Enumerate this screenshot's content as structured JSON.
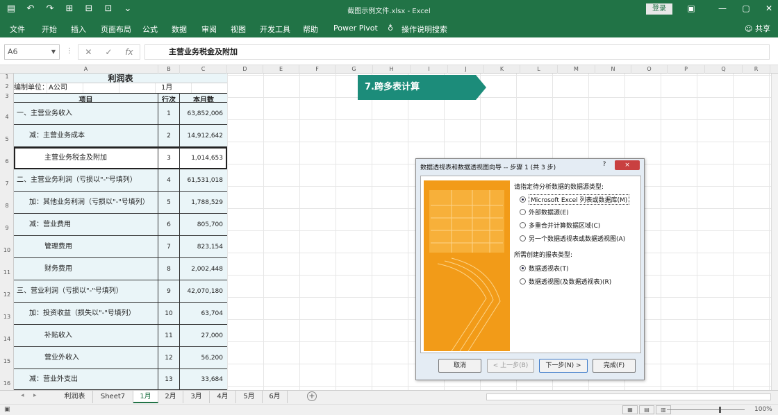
{
  "titlebar": {
    "doc_title": "截图示例文件.xlsx - Excel",
    "login_label": "登录",
    "icons": [
      "save-icon",
      "undo-icon",
      "redo-icon",
      "separator",
      "window-restore-icon",
      "minimize-icon",
      "maximize-icon",
      "close-icon"
    ]
  },
  "menu": {
    "tabs": [
      "文件",
      "开始",
      "插入",
      "页面布局",
      "公式",
      "数据",
      "审阅",
      "视图",
      "开发工具",
      "帮助",
      "Power Pivot",
      "操作说明搜索"
    ],
    "share": "共享"
  },
  "formula_bar": {
    "name_box": "A6",
    "value": "主营业务税金及附加"
  },
  "column_headers": [
    "A",
    "B",
    "C",
    "D",
    "E",
    "F",
    "G",
    "H",
    "I",
    "J",
    "K",
    "L",
    "M",
    "N",
    "O",
    "P",
    "Q",
    "R"
  ],
  "row_headers": [
    "1",
    "2",
    "3",
    "4",
    "5",
    "6",
    "7",
    "8",
    "9",
    "10",
    "11",
    "12",
    "13",
    "14",
    "15",
    "16"
  ],
  "table": {
    "title": "利润表",
    "unit_label": "编制单位：A公司",
    "month_label": "1月",
    "header": [
      "项目",
      "行次",
      "本月数"
    ],
    "rows": [
      {
        "item": "一、主营业务收入",
        "line": "1",
        "amount": "63,852,006"
      },
      {
        "item": "减：主营业务成本",
        "line": "2",
        "amount": "14,912,642"
      },
      {
        "item": "主营业务税金及附加",
        "line": "3",
        "amount": "1,014,653"
      },
      {
        "item": "二、主营业务利润（亏损以\"-\"号填列）",
        "line": "4",
        "amount": "61,531,018"
      },
      {
        "item": "加：其他业务利润（亏损以\"-\"号填列）",
        "line": "5",
        "amount": "1,788,529"
      },
      {
        "item": "减：营业费用",
        "line": "6",
        "amount": "805,700"
      },
      {
        "item": "管理费用",
        "line": "7",
        "amount": "823,154"
      },
      {
        "item": "财务费用",
        "line": "8",
        "amount": "2,002,448"
      },
      {
        "item": "三、营业利润（亏损以\"-\"号填列）",
        "line": "9",
        "amount": "42,070,180"
      },
      {
        "item": "加：投资收益（损失以\"-\"号填列）",
        "line": "10",
        "amount": "63,704"
      },
      {
        "item": "补贴收入",
        "line": "11",
        "amount": "27,000"
      },
      {
        "item": "营业外收入",
        "line": "12",
        "amount": "56,200"
      },
      {
        "item": "减：营业外支出",
        "line": "13",
        "amount": "33,684"
      }
    ]
  },
  "banner": {
    "text": "7.跨多表计算"
  },
  "dialog": {
    "title": "数据透视表和数据透视图向导 -- 步骤 1 (共 3 步)",
    "question_button": "?",
    "close_button": "×",
    "q1": "请指定待分析数据的数据源类型:",
    "sources": [
      {
        "label": "Microsoft Excel 列表或数据库(M)",
        "selected": true
      },
      {
        "label": "外部数据源(E)",
        "selected": false
      },
      {
        "label": "多重合并计算数据区域(C)",
        "selected": false
      },
      {
        "label": "另一个数据透视表或数据透视图(A)",
        "selected": false
      }
    ],
    "q2": "所需创建的报表类型:",
    "report_types": [
      {
        "label": "数据透视表(T)",
        "selected": true
      },
      {
        "label": "数据透视图(及数据透视表)(R)",
        "selected": false
      }
    ],
    "buttons": {
      "cancel": "取消",
      "back": "< 上一步(B)",
      "next": "下一步(N) >",
      "finish": "完成(F)"
    }
  },
  "sheets": {
    "tabs": [
      "利润表",
      "Sheet7",
      "1月",
      "2月",
      "3月",
      "4月",
      "5月",
      "6月"
    ],
    "active": "1月",
    "nav_prev": "◂",
    "nav_next": "▸",
    "add": "+"
  },
  "status": {
    "zoom": "100%"
  }
}
